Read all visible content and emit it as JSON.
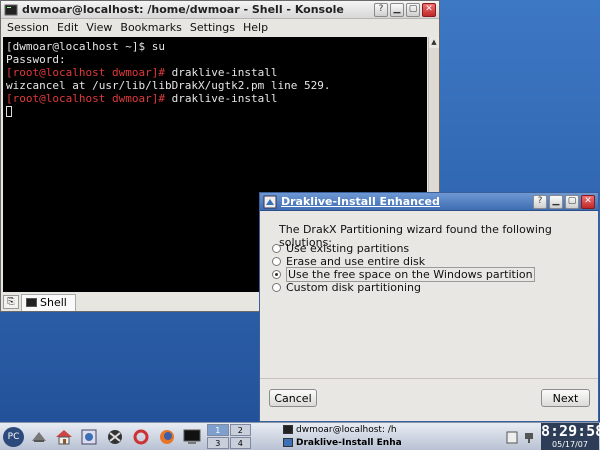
{
  "konsole": {
    "title": "dwmoar@localhost: /home/dwmoar - Shell - Konsole",
    "menu": [
      "Session",
      "Edit",
      "View",
      "Bookmarks",
      "Settings",
      "Help"
    ],
    "terminal": {
      "line1": "[dwmoar@localhost ~]$ su",
      "line2": "Password:",
      "line3_prompt": "[root@localhost dwmoar]#",
      "line3_cmd": " draklive-install",
      "line4": "wizcancel at /usr/lib/libDrakX/ugtk2.pm line 529.",
      "line5_prompt": "[root@localhost dwmoar]#",
      "line5_cmd": " draklive-install"
    },
    "tab_label": "Shell"
  },
  "dialog": {
    "title": "Draklive-Install Enhanced",
    "message": "The DrakX Partitioning wizard found the following solutions:",
    "options": [
      {
        "label": "Use existing partitions",
        "selected": false
      },
      {
        "label": "Erase and use entire disk",
        "selected": false
      },
      {
        "label": "Use the free space on the Windows partition",
        "selected": true
      },
      {
        "label": "Custom disk partitioning",
        "selected": false
      }
    ],
    "cancel_label": "Cancel",
    "next_label": "Next"
  },
  "taskbar": {
    "start_label": "PC",
    "pager": [
      "1",
      "2",
      "3",
      "4"
    ],
    "tasks": [
      "dwmoar@localhost: /h",
      "Draklive-Install Enha"
    ],
    "clock_time": "8:29:58",
    "clock_date": "05/17/07"
  },
  "colors": {
    "desktop": "#2e63ae",
    "prompt_red": "#e03a3a",
    "dialog_title": "#3f6db3"
  }
}
